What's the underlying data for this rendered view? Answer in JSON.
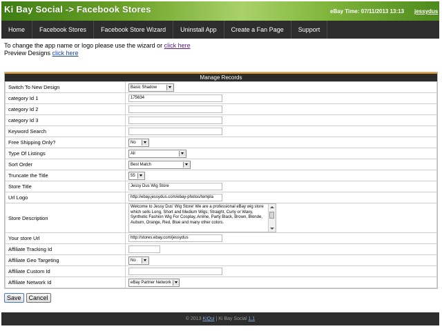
{
  "header": {
    "title": "Ki Bay Social -> Facebook Stores",
    "ebay_time": "eBay Time: 07/11/2013 13:13",
    "user": "jessydus"
  },
  "nav": {
    "items": [
      {
        "label": "Home"
      },
      {
        "label": "Facebook Stores"
      },
      {
        "label": "Facebook Store Wizard"
      },
      {
        "label": "Uninstall App"
      },
      {
        "label": "Create a Fan Page"
      },
      {
        "label": "Support"
      }
    ]
  },
  "intro": {
    "line1": "To change the app name or logo please use the wizard or ",
    "link1": "click here",
    "line2": "Preview Designs ",
    "link2": "click here"
  },
  "panel": {
    "title": "Manage Records",
    "rows": {
      "switch_design": {
        "label": "Switch To New Design",
        "value": "Basic Shadow"
      },
      "category1": {
        "label": "category Id 1",
        "value": "175634"
      },
      "category2": {
        "label": "category Id 2",
        "value": ""
      },
      "category3": {
        "label": "category Id 3",
        "value": ""
      },
      "keyword": {
        "label": "Keyword Search",
        "value": ""
      },
      "free_shipping": {
        "label": "Free Shipping Only?",
        "value": "No"
      },
      "listing_type": {
        "label": "Type Of Listings",
        "value": "All"
      },
      "sort_order": {
        "label": "Sort Order",
        "value": "Best Match"
      },
      "truncate": {
        "label": "Truncate the Title",
        "value": "55"
      },
      "store_title": {
        "label": "Store Title",
        "value": "Jessy Dus Wig Store"
      },
      "url_logo": {
        "label": "Url Logo",
        "value": "http://ebay.jessydus.com/ebay-photos/templa"
      },
      "store_description": {
        "label": "Store Description",
        "value": "Welcome to Jessy Dus' Wig Store! We are a professional eBay wig store which sells Long, Short and Medium Wigs; Straight, Curly or Wavy, Synthetic Fashion Wig For Cosplay, Anime, Party Black, Brown, Blonde, Auburn, Orange, Red, Blue and many other colors."
      },
      "store_url": {
        "label": "Your store Url",
        "value": "http://stores.ebay.com/jessydus"
      },
      "aff_tracking": {
        "label": "Affiliate Tracking Id",
        "value": ""
      },
      "aff_geo": {
        "label": "Affiliate Geo Targeting",
        "value": "No"
      },
      "aff_custom": {
        "label": "Affiliate Custom Id",
        "value": ""
      },
      "aff_network": {
        "label": "Affiliate Network Id",
        "value": "eBay Partner Network"
      }
    }
  },
  "buttons": {
    "save": "Save",
    "cancel": "Cancel"
  },
  "footer": {
    "prefix": "© 2013 ",
    "brand": "KiQui",
    "middle": " | Ki Bay Social ",
    "version": "1.1"
  }
}
